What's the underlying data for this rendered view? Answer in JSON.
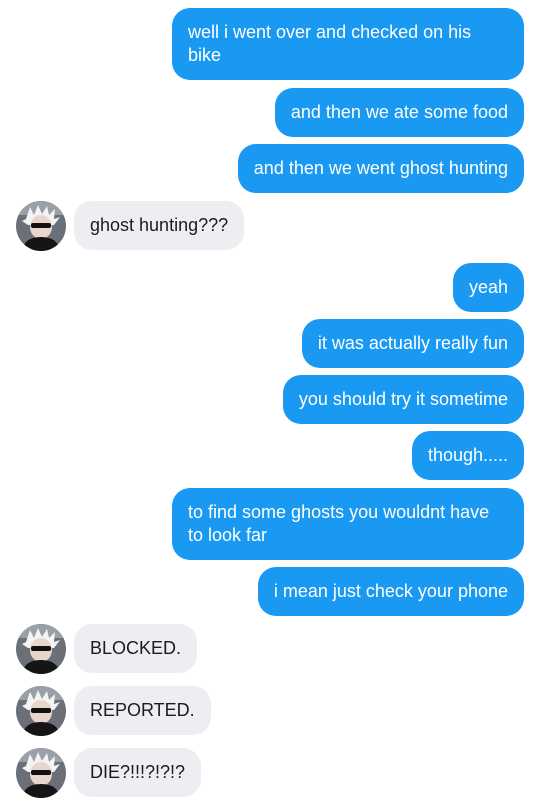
{
  "conversation": {
    "messages": [
      {
        "from": "me",
        "text": "well i went over and checked on his bike"
      },
      {
        "from": "me",
        "text": "and then we ate some food"
      },
      {
        "from": "me",
        "text": "and then we went ghost hunting"
      },
      {
        "from": "them",
        "text": "ghost hunting???"
      },
      {
        "from": "me",
        "text": "yeah"
      },
      {
        "from": "me",
        "text": "it was actually really fun"
      },
      {
        "from": "me",
        "text": "you should try it sometime"
      },
      {
        "from": "me",
        "text": "though....."
      },
      {
        "from": "me",
        "text": "to find some ghosts you wouldnt have to look far"
      },
      {
        "from": "me",
        "text": "i mean just check your phone"
      },
      {
        "from": "them",
        "text": "BLOCKED."
      },
      {
        "from": "them",
        "text": "REPORTED."
      },
      {
        "from": "them",
        "text": "DIE?!!!?!?!?"
      }
    ]
  },
  "colors": {
    "outgoing_bubble": "#1a99f2",
    "incoming_bubble": "#eceef1",
    "outgoing_text": "#ffffff",
    "incoming_text": "#1c1c1e"
  },
  "icons": {
    "contact_avatar": "white-haired-person-avatar"
  }
}
